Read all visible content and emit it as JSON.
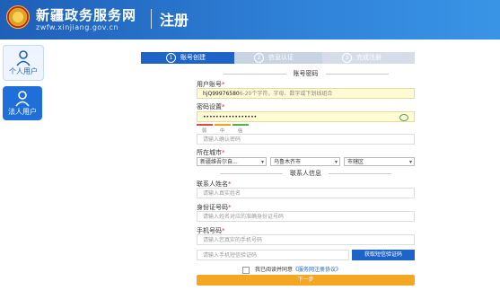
{
  "header": {
    "site_name": "新疆政务服务网",
    "site_url": "zwfw.xinjiang.gov.cn",
    "page_title": "注册"
  },
  "sidebar": {
    "items": [
      {
        "label": "个人用户",
        "icon": "person-icon"
      },
      {
        "label": "法人用户",
        "icon": "person-icon"
      }
    ]
  },
  "steps": [
    {
      "num": "1",
      "label": "账号创建"
    },
    {
      "num": "2",
      "label": "信息认证"
    },
    {
      "num": "3",
      "label": "完成注册"
    }
  ],
  "account_section": {
    "title": "账号密码",
    "username_label": "用户账号",
    "username_value": "hjQ99976580",
    "username_hint": "6-20个字符，字母、数字或下划线组合",
    "password_label": "密码设置",
    "password_value": "•••••••••••••••••",
    "strength": [
      "弱",
      "中",
      "强"
    ],
    "confirm_placeholder": "请输入确认密码",
    "city_label": "所在城市",
    "city_values": [
      "新疆维吾尔自...",
      "乌鲁木齐市",
      "市辖区"
    ]
  },
  "contact_section": {
    "title": "联系人信息",
    "name_label": "联系人姓名",
    "name_placeholder": "请输入真实姓名",
    "id_label": "身份证号码",
    "id_placeholder": "请输入姓名对应的准确身份证号码",
    "phone_label": "手机号码",
    "phone_placeholder": "请输入您真实的手机号码",
    "sms_placeholder": "请输入手机短信验证码",
    "sms_button": "获取短信验证码"
  },
  "agreement": {
    "text": "我已阅读并同意",
    "link": "《服务网注册协议》"
  },
  "next_button": "下一步",
  "colors": {
    "header": "#2f82d8",
    "primary": "#1e64c8",
    "next_button": "#f5a623",
    "filled_field": "#fffbd6"
  }
}
